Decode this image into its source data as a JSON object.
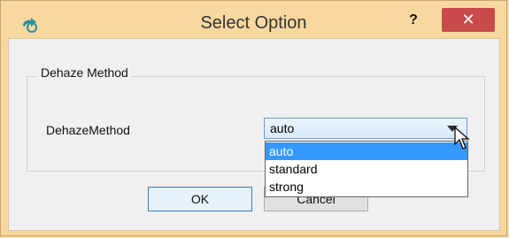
{
  "window": {
    "title": "Select Option",
    "help_label": "?",
    "close_label": "✕"
  },
  "group": {
    "title": "Dehaze Method"
  },
  "form": {
    "label": "DehazeMethod",
    "selected_value": "auto",
    "options": [
      "auto",
      "standard",
      "strong"
    ]
  },
  "buttons": {
    "ok": "OK",
    "cancel": "Cancel"
  },
  "colors": {
    "titlebar": "#f9d8a0",
    "close": "#c94a4a",
    "selection": "#3399ff"
  }
}
